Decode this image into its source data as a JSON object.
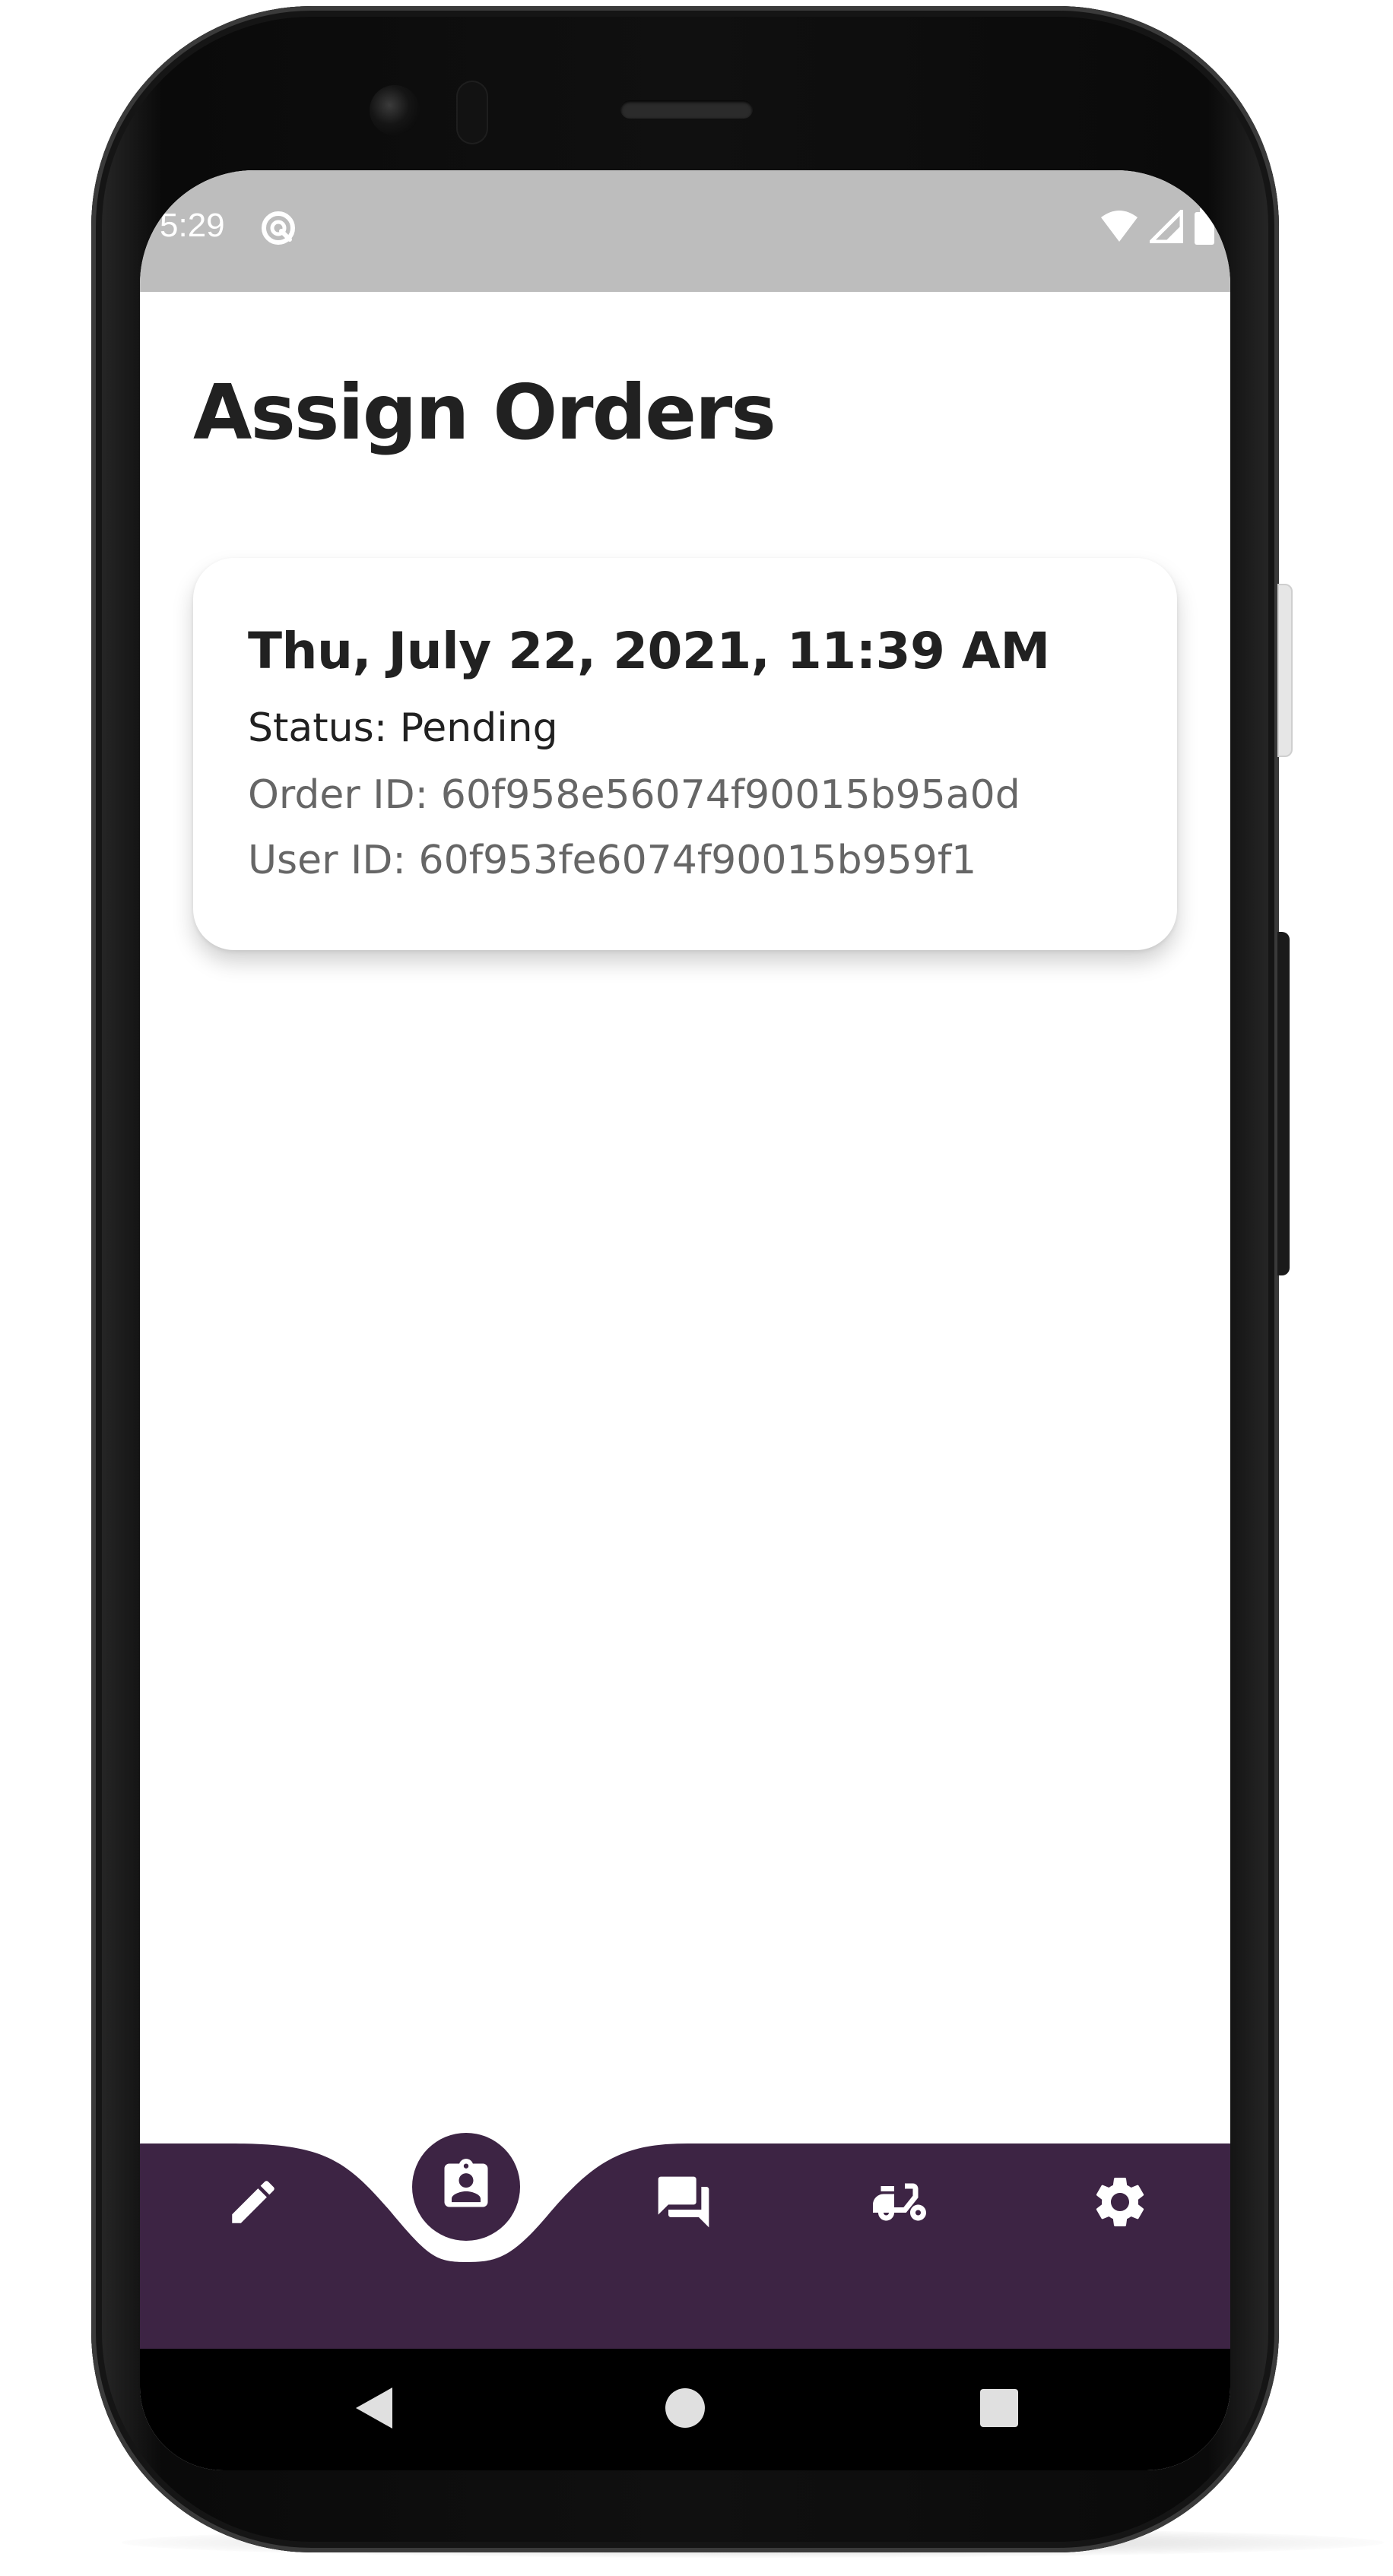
{
  "status_bar": {
    "time": "5:29",
    "app_icon": "app-indicator-icon",
    "right_icons": [
      "wifi-icon",
      "signal-icon",
      "battery-icon"
    ]
  },
  "page": {
    "title": "Assign Orders"
  },
  "orders": [
    {
      "date": "Thu, July 22, 2021, 11:39 AM",
      "status": "Status: Pending",
      "order_id": "Order ID: 60f958e56074f90015b95a0d",
      "user_id": "User ID: 60f953fe6074f90015b959f1"
    }
  ],
  "bottom_nav": {
    "active_index": 1,
    "items": [
      {
        "icon": "pencil-icon"
      },
      {
        "icon": "assignment-ind-icon"
      },
      {
        "icon": "forum-icon"
      },
      {
        "icon": "delivery-scooter-icon"
      },
      {
        "icon": "gear-icon"
      }
    ]
  },
  "system_nav": {
    "buttons": [
      "back-triangle-icon",
      "home-circle-icon",
      "recents-square-icon"
    ]
  },
  "colors": {
    "nav_bg": "#3d2444",
    "status_bar_bg": "#bdbdbd",
    "title_text": "#212121",
    "secondary_text": "#666666"
  }
}
